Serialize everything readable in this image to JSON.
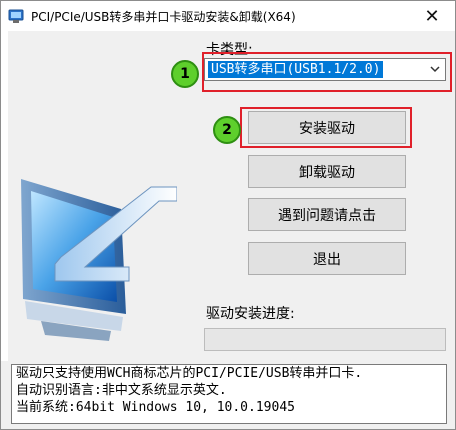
{
  "window": {
    "title": "PCI/PCIe/USB转多串并口卡驱动安装&卸载(X64)",
    "close_glyph": "✕"
  },
  "card_type": {
    "label": "卡类型:",
    "selected": "USB转多串口(USB1.1/2.0)"
  },
  "badges": [
    "1",
    "2"
  ],
  "buttons": {
    "install": "安装驱动",
    "uninstall": "卸载驱动",
    "help": "遇到问题请点击",
    "exit": "退出"
  },
  "progress": {
    "label": "驱动安装进度:",
    "value_percent": 0
  },
  "info": {
    "lines": [
      "驱动只支持使用WCH商标芯片的PCI/PCIE/USB转串并口卡.",
      "自动识别语言:非中文系统显示英文.",
      "当前系统:64bit Windows 10, 10.0.19045"
    ]
  },
  "colors": {
    "highlight": "#e0202a",
    "badge": "#5ecf2c",
    "selection": "#0078d7"
  },
  "icons": [
    "app-icon",
    "close-icon",
    "computer-monitor-icon",
    "chevron-down-icon"
  ]
}
